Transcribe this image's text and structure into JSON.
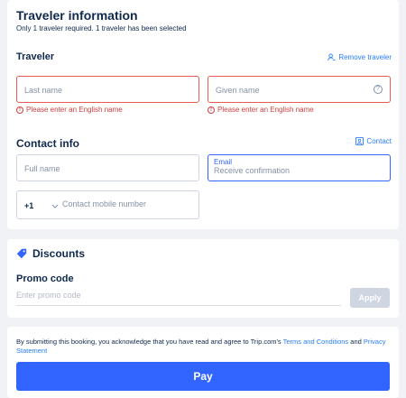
{
  "traveler_info": {
    "title": "Traveler information",
    "subtitle": "Only 1 traveler required. 1 traveler has been selected",
    "traveler_label": "Traveler",
    "remove_label": "Remove traveler",
    "last_name_placeholder": "Last name",
    "given_name_placeholder": "Given name",
    "error_text": "Please enter an English name",
    "error_glyph": "!",
    "help_glyph": "?"
  },
  "contact": {
    "title": "Contact info",
    "contact_link": "Contact",
    "full_name_placeholder": "Full name",
    "email_label": "Email",
    "email_placeholder": "Receive confirmation",
    "country_code": "+1",
    "mobile_placeholder": "Contact mobile number"
  },
  "discounts": {
    "title": "Discounts",
    "promo_label": "Promo code",
    "promo_placeholder": "Enter promo code",
    "apply_label": "Apply"
  },
  "footer": {
    "terms_prefix": "By submitting this booking, you acknowledge that you have read and agree to Trip.com's ",
    "terms_link": "Terms and Conditions",
    "terms_and": " and ",
    "privacy_link": "Privacy Statement",
    "pay_label": "Pay"
  },
  "colors": {
    "accent": "#3264ff",
    "error": "#e65c53",
    "link": "#287dfa"
  }
}
